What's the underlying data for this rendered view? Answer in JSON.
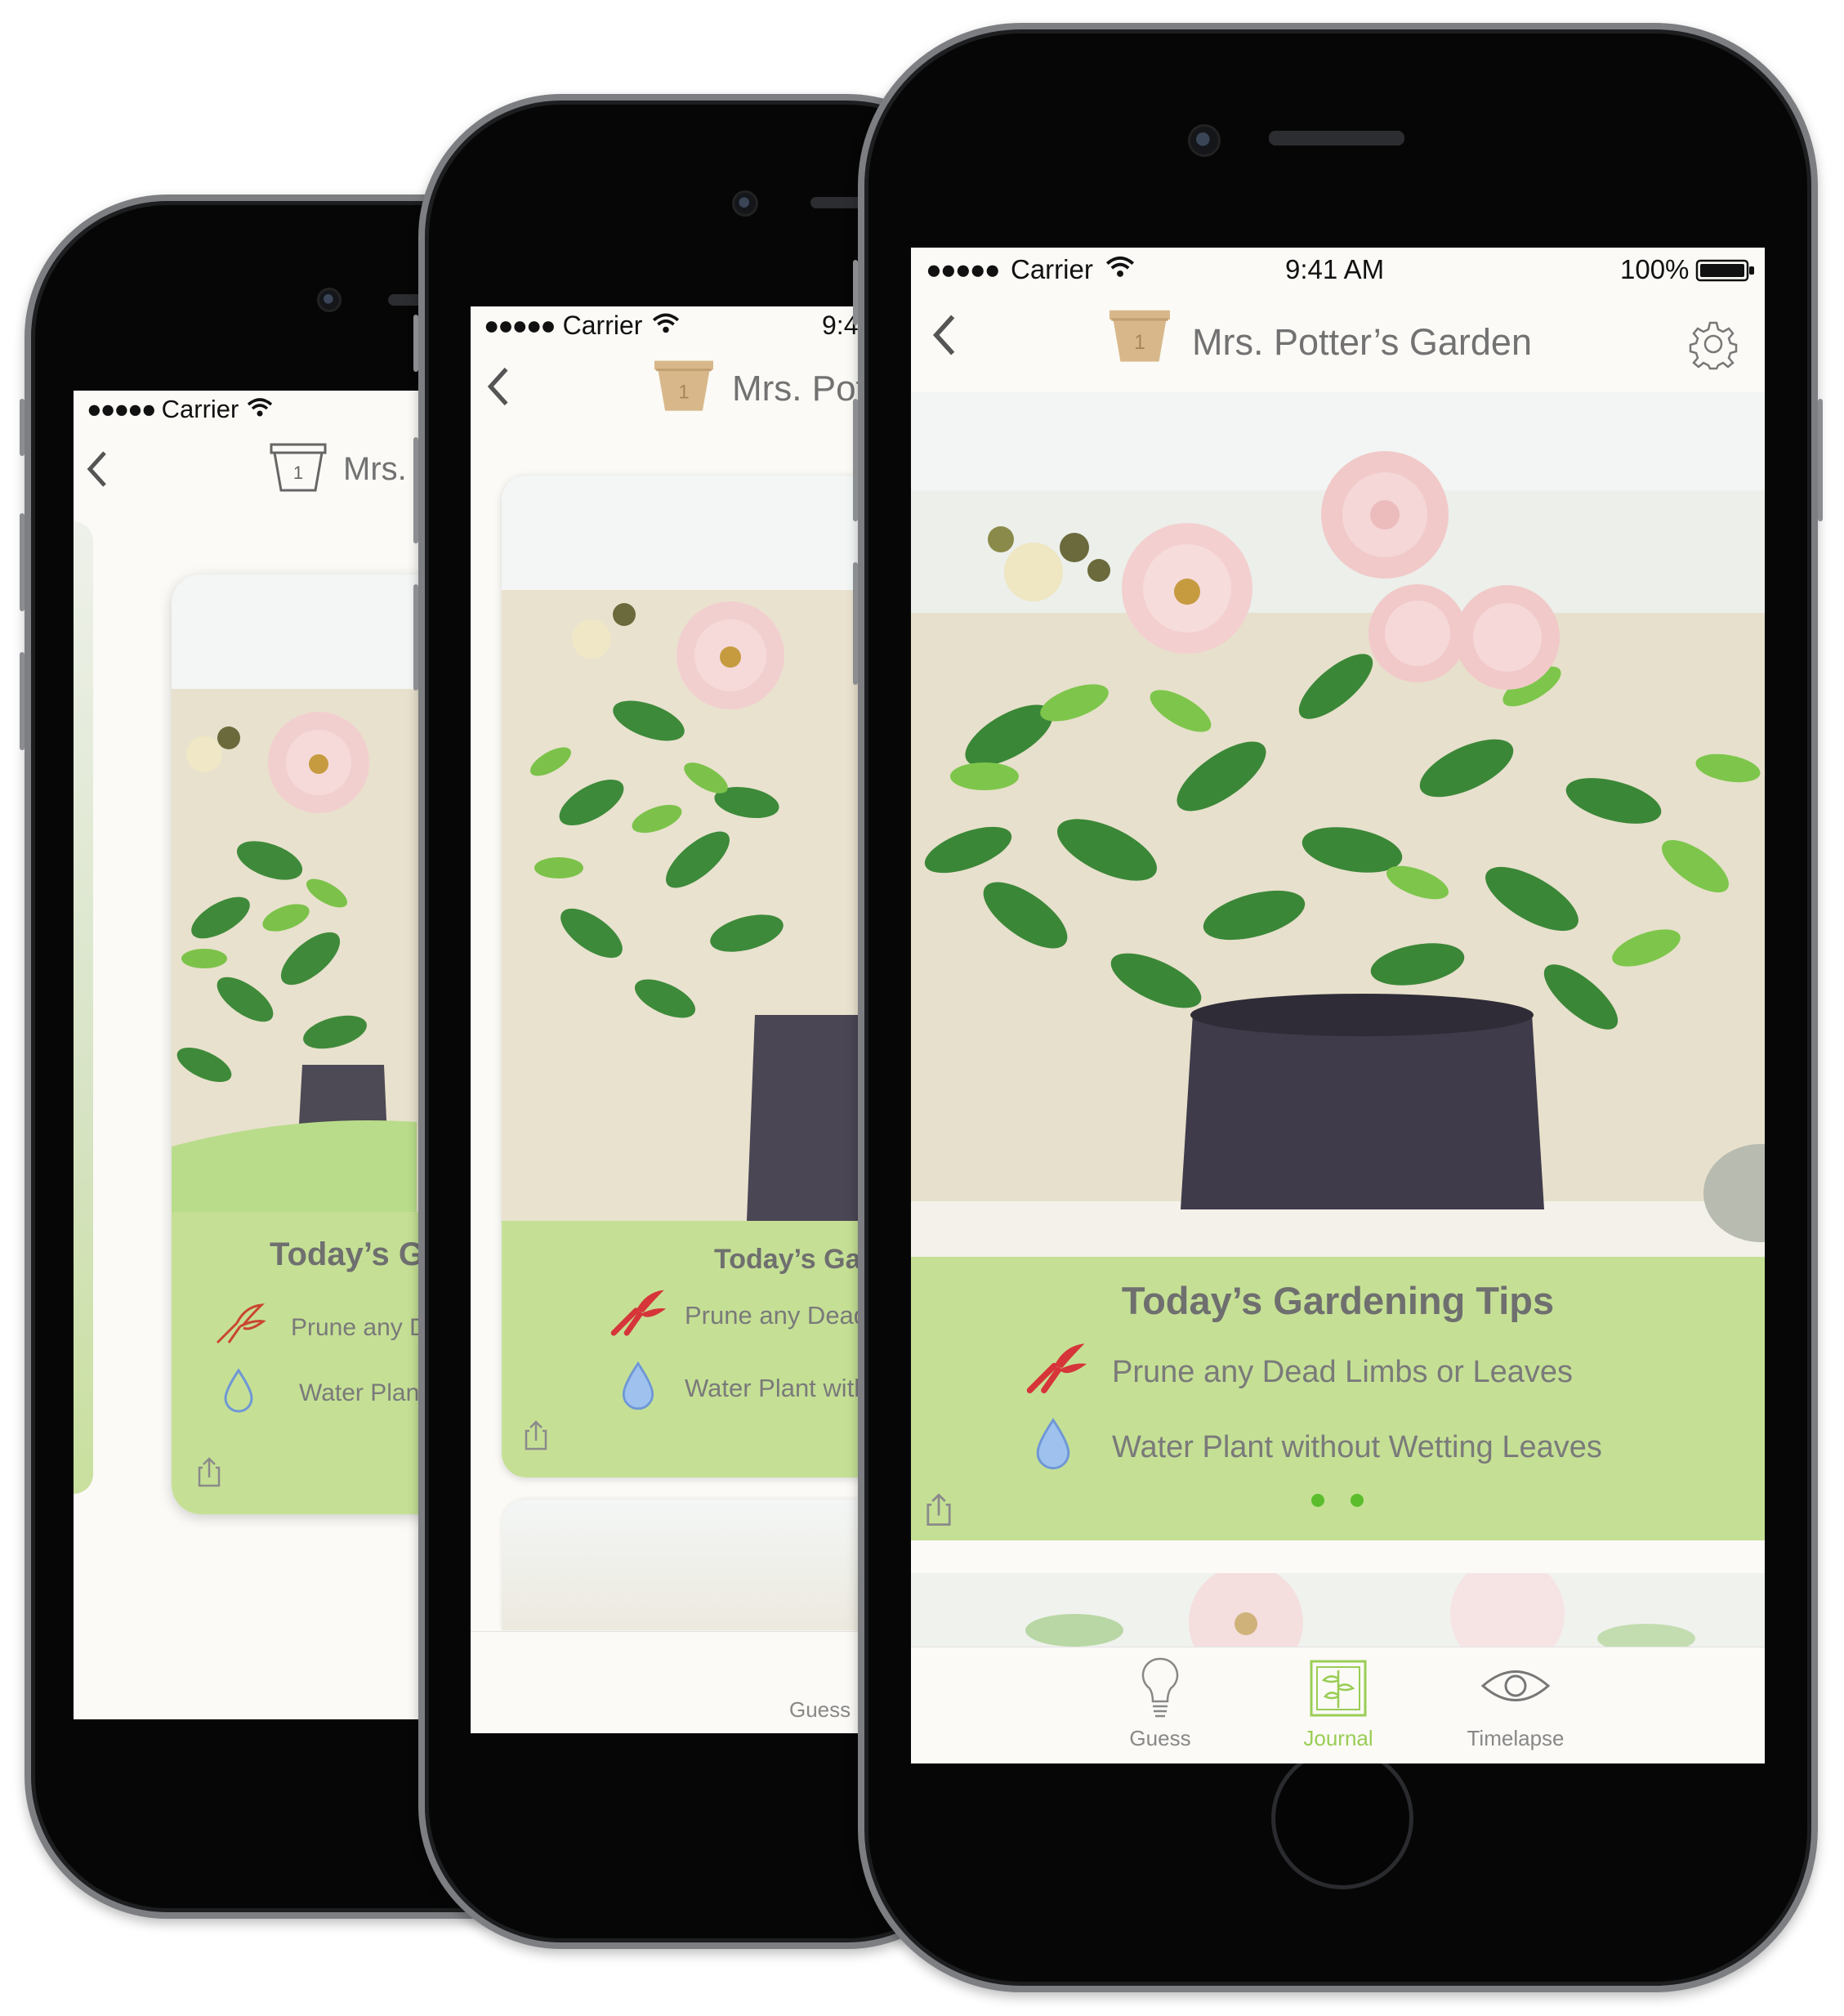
{
  "status": {
    "signal": "●●●●●",
    "carrier": "Carrier",
    "time": "9:41 AM",
    "battery": "100%"
  },
  "nav": {
    "title": "Mrs. Potter’s Garden",
    "pot_number": "1"
  },
  "tips": {
    "title": "Today’s Gardening Tips",
    "items": [
      {
        "icon": "pruning-shears-icon",
        "text": "Prune any Dead Limbs or Leaves"
      },
      {
        "icon": "water-drop-icon",
        "text": "Water Plant without Wetting Leaves"
      }
    ],
    "page_dots": 2
  },
  "tabs": [
    {
      "label": "Guess",
      "icon": "lightbulb-icon"
    },
    {
      "label": "Journal",
      "icon": "journal-icon",
      "active": true
    },
    {
      "label": "Timelapse",
      "icon": "eye-icon"
    }
  ],
  "colors": {
    "tips_panel": "#c5e095",
    "active_tab": "#9acd55",
    "shears": "#d6353a",
    "water": "#9ec1ee",
    "pot": "#d8b88a"
  }
}
